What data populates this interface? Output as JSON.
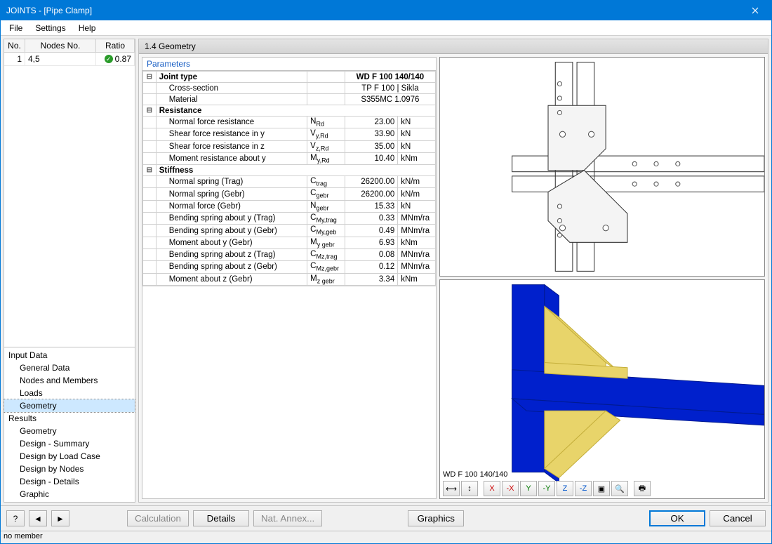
{
  "window": {
    "title": "JOINTS - [Pipe Clamp]"
  },
  "menu": {
    "file": "File",
    "settings": "Settings",
    "help": "Help"
  },
  "left": {
    "headers": {
      "no": "No.",
      "nodes": "Nodes No.",
      "ratio": "Ratio"
    },
    "rows": [
      {
        "no": "1",
        "nodes": "4,5",
        "ratio": "0.87"
      }
    ],
    "tree": {
      "input": "Input Data",
      "input_items": [
        "General Data",
        "Nodes and Members",
        "Loads",
        "Geometry"
      ],
      "results": "Results",
      "results_items": [
        "Geometry",
        "Design - Summary",
        "Design by Load Case",
        "Design by Nodes",
        "Design - Details",
        "Graphic"
      ],
      "selected": "Geometry"
    }
  },
  "main": {
    "header": "1.4 Geometry",
    "params_title": "Parameters",
    "groups": {
      "joint_type": {
        "label": "Joint type",
        "value": "WD F 100 140/140",
        "rows": [
          {
            "label": "Cross-section",
            "value": "TP F 100 | Sikla"
          },
          {
            "label": "Material",
            "value": "S355MC 1.0976"
          }
        ]
      },
      "resistance": {
        "label": "Resistance",
        "rows": [
          {
            "label": "Normal force resistance",
            "sym": "N",
            "sub": "Rd",
            "value": "23.00",
            "unit": "kN"
          },
          {
            "label": "Shear force resistance in y",
            "sym": "V",
            "sub": "y,Rd",
            "value": "33.90",
            "unit": "kN"
          },
          {
            "label": "Shear force resistance in z",
            "sym": "V",
            "sub": "z,Rd",
            "value": "35.00",
            "unit": "kN"
          },
          {
            "label": "Moment resistance about y",
            "sym": "M",
            "sub": "y,Rd",
            "value": "10.40",
            "unit": "kNm"
          }
        ]
      },
      "stiffness": {
        "label": "Stiffness",
        "rows": [
          {
            "label": "Normal spring (Trag)",
            "sym": "C",
            "sub": "trag",
            "value": "26200.00",
            "unit": "kN/m"
          },
          {
            "label": "Normal spring (Gebr)",
            "sym": "C",
            "sub": "gebr",
            "value": "26200.00",
            "unit": "kN/m"
          },
          {
            "label": "Normal force (Gebr)",
            "sym": "N",
            "sub": "gebr",
            "value": "15.33",
            "unit": "kN"
          },
          {
            "label": "Bending spring about y (Trag)",
            "sym": "C",
            "sub": "My,trag",
            "value": "0.33",
            "unit": "MNm/ra"
          },
          {
            "label": "Bending spring about y (Gebr)",
            "sym": "C",
            "sub": "My,geb",
            "value": "0.49",
            "unit": "MNm/ra"
          },
          {
            "label": "Moment about y (Gebr)",
            "sym": "M",
            "sub": "y gebr",
            "value": "6.93",
            "unit": "kNm"
          },
          {
            "label": "Bending spring about z (Trag)",
            "sym": "C",
            "sub": "Mz,trag",
            "value": "0.08",
            "unit": "MNm/ra"
          },
          {
            "label": "Bending spring about z (Gebr)",
            "sym": "C",
            "sub": "Mz,gebr",
            "value": "0.12",
            "unit": "MNm/ra"
          },
          {
            "label": "Moment about z (Gebr)",
            "sym": "M",
            "sub": "z gebr",
            "value": "3.34",
            "unit": "kNm"
          }
        ]
      }
    }
  },
  "view": {
    "model_label": "WD F 100 140/140"
  },
  "buttons": {
    "calculation": "Calculation",
    "details": "Details",
    "nat_annex": "Nat. Annex...",
    "graphics": "Graphics",
    "ok": "OK",
    "cancel": "Cancel"
  },
  "status": "no member"
}
